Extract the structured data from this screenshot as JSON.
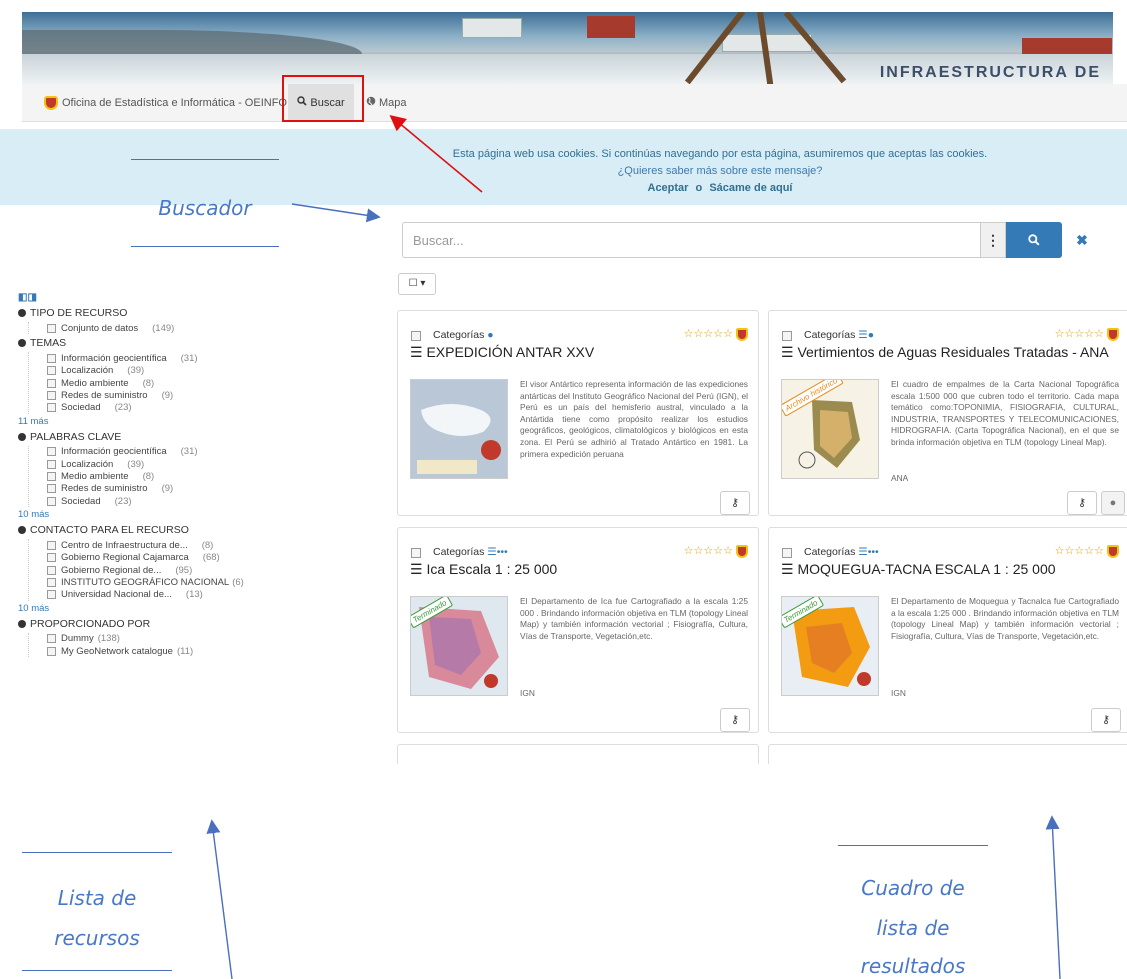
{
  "nav": {
    "org_label": "Oficina de Estadística e Informática - OEINFO",
    "search_label": "Buscar",
    "map_label": "Mapa"
  },
  "banner": {
    "text": "INFRAESTRUCTURA DE"
  },
  "cookie": {
    "line1": "Esta página web usa cookies. Si continúas navegando por esta página, asumiremos que aceptas las cookies.",
    "line2": "¿Quieres saber más sobre este mensaje?",
    "accept": "Aceptar",
    "or": "o",
    "leave": "Sácame de aquí"
  },
  "search": {
    "placeholder": "Buscar...",
    "more_icon": "vertical-dots-icon",
    "search_icon": "search-icon",
    "clear_icon": "close-icon"
  },
  "annotations": {
    "buscador": "Buscador",
    "lista_recursos": [
      "Lista de",
      "recursos"
    ],
    "cuadro_lista": [
      "Cuadro de",
      "lista de",
      "resultados"
    ]
  },
  "facets": [
    {
      "title": "TIPO DE RECURSO",
      "items": [
        {
          "name": "Conjunto de datos",
          "count": "(149)"
        }
      ],
      "more": ""
    },
    {
      "title": "TEMAS",
      "items": [
        {
          "name": "Información geocientífica",
          "count": "(31)"
        },
        {
          "name": "Localización",
          "count": "(39)"
        },
        {
          "name": "Medio ambiente",
          "count": "(8)"
        },
        {
          "name": "Redes de suministro",
          "count": "(9)"
        },
        {
          "name": "Sociedad",
          "count": "(23)"
        }
      ],
      "more": "11 más"
    },
    {
      "title": "PALABRAS CLAVE",
      "items": [
        {
          "name": "Información geocientífica",
          "count": "(31)"
        },
        {
          "name": "Localización",
          "count": "(39)"
        },
        {
          "name": "Medio ambiente",
          "count": "(8)"
        },
        {
          "name": "Redes de suministro",
          "count": "(9)"
        },
        {
          "name": "Sociedad",
          "count": "(23)"
        }
      ],
      "more": "10 más"
    },
    {
      "title": "CONTACTO PARA EL RECURSO",
      "items": [
        {
          "name": "Centro de Infraestructura de...",
          "count": "(8)"
        },
        {
          "name": "Gobierno Regional Cajamarca",
          "count": "(68)"
        },
        {
          "name": "Gobierno Regional de...",
          "count": "(95)"
        },
        {
          "name": "INSTITUTO GEOGRÁFICO NACIONAL",
          "count": "(6)"
        },
        {
          "name": "Universidad Nacional de...",
          "count": "(13)"
        }
      ],
      "more": "10 más"
    },
    {
      "title": "PROPORCIONADO POR",
      "items": [
        {
          "name": "Dummy",
          "count": "(138)"
        },
        {
          "name": "My GeoNetwork catalogue",
          "count": "(11)"
        }
      ],
      "more": ""
    }
  ],
  "results": [
    {
      "category_label": "Categorías",
      "title": "EXPEDICIÓN ANTAR XXV",
      "description": "El visor Antártico representa información de las expediciones antárticas del Instituto Geográfico Nacional del Perú (IGN), el Perú es un país del hemisferio austral, vinculado a la Antártida tiene como propósito realizar los estudios geográficos, geológicos, climatológicos y biológicos en esta zona. El Perú se adhirió al Tratado Antártico en 1981. La primera expedición peruana",
      "org": "",
      "ribbon": "",
      "rating": "☆☆☆☆☆"
    },
    {
      "category_label": "Categorías",
      "title": "Vertimientos de Aguas Residuales Tratadas - ANA",
      "description": "El cuadro de empalmes de la Carta Nacional Topográfica escala 1:500 000 que cubren todo el territorio. Cada mapa temático como:TOPONIMIA, FISIOGRAFIA, CULTURAL, INDUSTRIA, TRANSPORTES Y TELECOMUNICACIONES, HIDROGRAFIA. (Carta Topográfica Nacional), en el que se brinda información objetiva en TLM (topology Lineal Map).",
      "org": "ANA",
      "ribbon": "Archivo histórico",
      "rating": "☆☆☆☆☆"
    },
    {
      "category_label": "Categorías",
      "title": "Ica Escala 1 : 25 000",
      "description": "El Departamento de Ica fue Cartografiado a la escala 1:25 000 . Brindando información objetiva en TLM (topology Lineal Map) y también información vectorial ; Fisiografía, Cultura, Vías de Transporte, Vegetación,etc.",
      "org": "IGN",
      "ribbon": "Terminado",
      "rating": "☆☆☆☆☆"
    },
    {
      "category_label": "Categorías",
      "title": "MOQUEGUA-TACNA ESCALA 1 : 25 000",
      "description": "El Departamento de Moquegua y Tacnalca fue Cartografiado a la escala 1:25 000 . Brindando información objetiva en TLM (topology Lineal Map) y también información vectorial ; Fisiografía, Cultura, Vías de Transporte, Vegetación,etc.",
      "org": "IGN",
      "ribbon": "Terminado",
      "rating": "☆☆☆☆☆"
    }
  ],
  "colors": {
    "accent": "#337ab7",
    "cookie_bg": "#d9edf7",
    "highlight_box": "#e01010",
    "annotation": "#4a78c8"
  }
}
